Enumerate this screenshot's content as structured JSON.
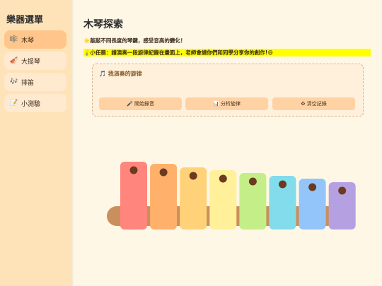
{
  "sidebar": {
    "title": "樂器選單",
    "items": [
      {
        "icon": "🎼",
        "label": "木琴",
        "active": true
      },
      {
        "icon": "🎻",
        "label": "大提琴",
        "active": false
      },
      {
        "icon": "🎶",
        "label": "排笛",
        "active": false
      },
      {
        "icon": "📝",
        "label": "小測驗",
        "active": false
      }
    ]
  },
  "main": {
    "title": "木琴探索",
    "intro": "⭐敲敲不同長度的琴鍵，感受音高的變化！",
    "task": "💡小任務：請演奏一段旋律紀錄在畫面上，老師會請你們和同學分享你的創作!😄"
  },
  "panel": {
    "title": "🎵 我演奏的旋律",
    "buttons": [
      {
        "icon": "🎤",
        "label": "開始錄音"
      },
      {
        "icon": "📊",
        "label": "分析旋律"
      },
      {
        "icon": "♻",
        "label": "清空記錄"
      }
    ]
  },
  "xylophone": {
    "bar_colors": [
      "#ff857d",
      "#ffb06a",
      "#ffd27a",
      "#fff099",
      "#c3ee88",
      "#82dcec",
      "#93c5fb",
      "#b5a1e2"
    ],
    "stand_color": "#c98f5c",
    "dot_color": "#6b3a1f"
  }
}
